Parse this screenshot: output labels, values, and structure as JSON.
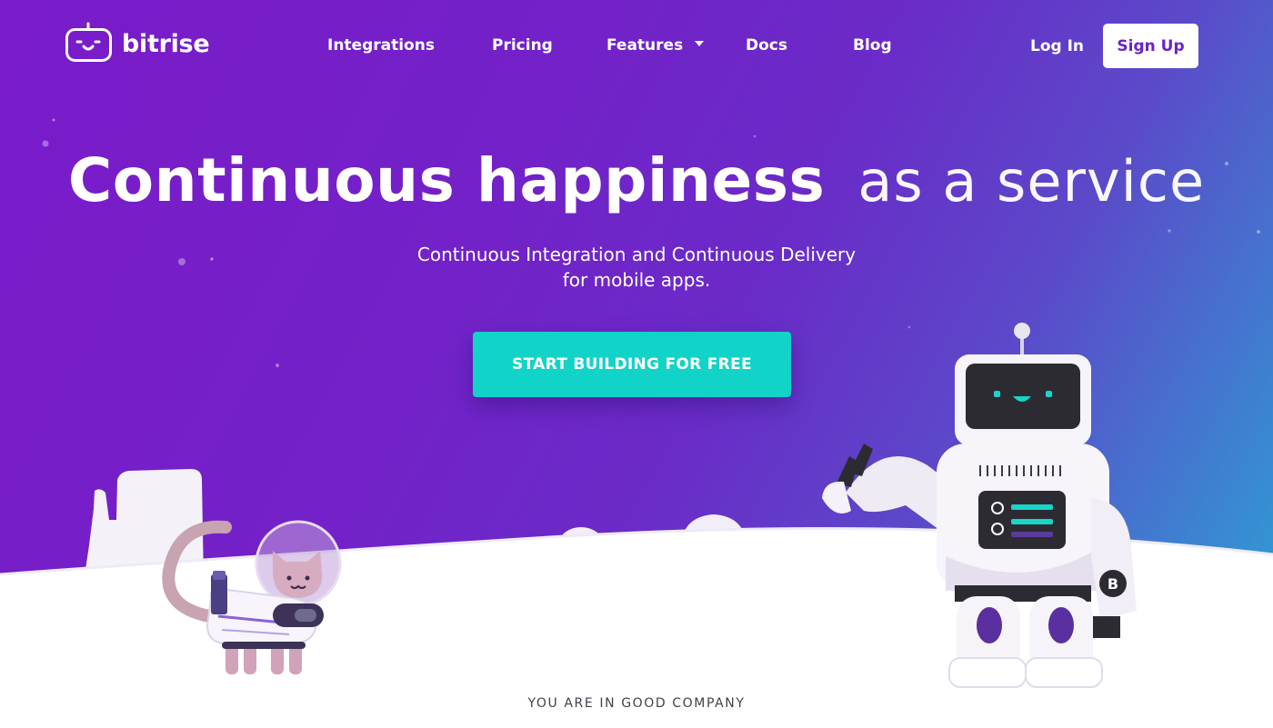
{
  "brand": {
    "name": "bitrise",
    "logo_icon": "bitrise-robot-face-icon"
  },
  "nav": {
    "links": [
      "Integrations",
      "Pricing",
      "Features",
      "Docs",
      "Blog"
    ],
    "features_caret_icon": "chevron-down-icon",
    "login": "Log In",
    "signup": "Sign Up"
  },
  "hero": {
    "headline_bold": "Continuous happiness",
    "headline_light": "as a service",
    "subline_1": "Continuous Integration and Continuous Delivery",
    "subline_2": "for mobile apps.",
    "cta": "START BUILDING FOR FREE"
  },
  "illustration": {
    "robot_badge": "B",
    "robot_icon": "robot-illustration",
    "cat_icon": "astronaut-cat-illustration"
  },
  "footer_teaser": "YOU ARE IN GOOD COMPANY",
  "colors": {
    "gradient_start": "#7a1bc9",
    "gradient_end": "#28a8d6",
    "cta": "#12d3c8",
    "ground": "#ffffff",
    "text_dark": "#41424b"
  }
}
